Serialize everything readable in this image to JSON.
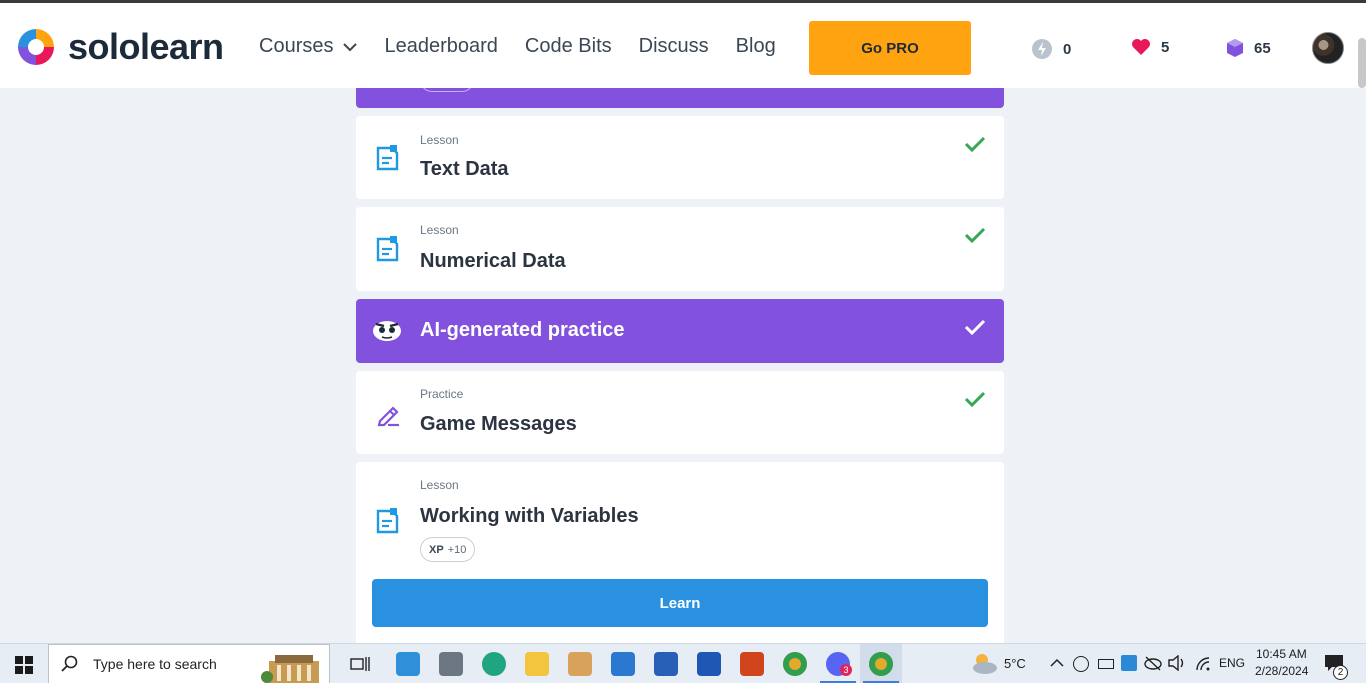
{
  "nav": {
    "brand": "sololearn",
    "items": [
      {
        "label": "Courses"
      },
      {
        "label": "Leaderboard"
      },
      {
        "label": "Code Bits"
      },
      {
        "label": "Discuss"
      },
      {
        "label": "Blog"
      }
    ],
    "go_pro": "Go PRO",
    "stats": {
      "energy": "0",
      "hearts": "5",
      "gems": "65"
    },
    "colors": {
      "accent": "#ffa310",
      "heart": "#e8195a",
      "gem": "#8251de",
      "energy": "#9aa6b2"
    }
  },
  "cards": [
    {
      "kind": "Lesson",
      "title": "Text Data",
      "completed": true
    },
    {
      "kind": "Lesson",
      "title": "Numerical Data",
      "completed": true
    }
  ],
  "ai_practice": {
    "title": "AI-generated practice",
    "completed": true
  },
  "practice": {
    "kind": "Practice",
    "title": "Game Messages",
    "completed": true
  },
  "next_lesson": {
    "kind": "Lesson",
    "title": "Working with Variables",
    "xp_label": "XP",
    "xp_value": "+10",
    "learn": "Learn"
  },
  "colors": {
    "purple": "#8251de",
    "blue": "#2a91e0",
    "check": "#34a853",
    "lesson_icon": "#1f9ae0"
  },
  "taskbar": {
    "search_placeholder": "Type here to search",
    "weather": "5°C",
    "language": "ENG",
    "time": "10:45 AM",
    "date": "2/28/2024",
    "notifications": "2",
    "discord_badge": "3"
  }
}
